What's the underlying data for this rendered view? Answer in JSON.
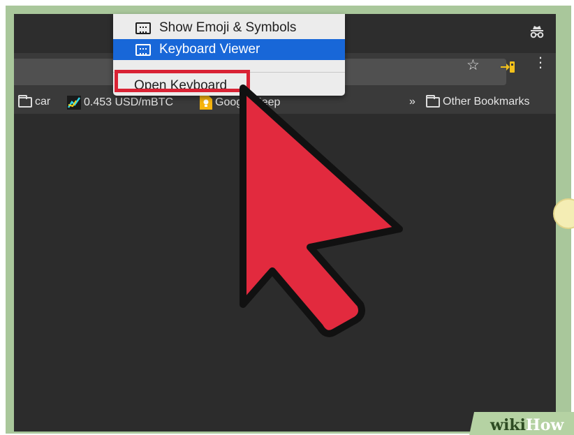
{
  "menu": {
    "items": [
      {
        "label": "Show Emoji & Symbols",
        "icon": "emoji-keyboard-icon"
      },
      {
        "label": "Keyboard Viewer",
        "icon": "keyboard-icon",
        "highlighted": true
      }
    ],
    "open_keyboard_label": "Open Keyboard"
  },
  "bookmarks": {
    "items": [
      {
        "label": "car",
        "icon": "folder-icon"
      },
      {
        "label": "0.453 USD/mBTC",
        "icon": "chart-icon"
      },
      {
        "label": "Google Keep",
        "icon": "keep-icon"
      }
    ],
    "overflow_label": "»",
    "other_label": "Other Bookmarks"
  },
  "toolbar": {
    "star_glyph": "☆",
    "menu_glyph": "⋮"
  },
  "watermark": {
    "brand_wiki": "wiki",
    "brand_how": "How"
  },
  "colors": {
    "menu_highlight": "#1867d8",
    "arrow_fill": "#e22a3e",
    "highlight_box": "#d92234",
    "frame_green": "#a9c79b"
  }
}
